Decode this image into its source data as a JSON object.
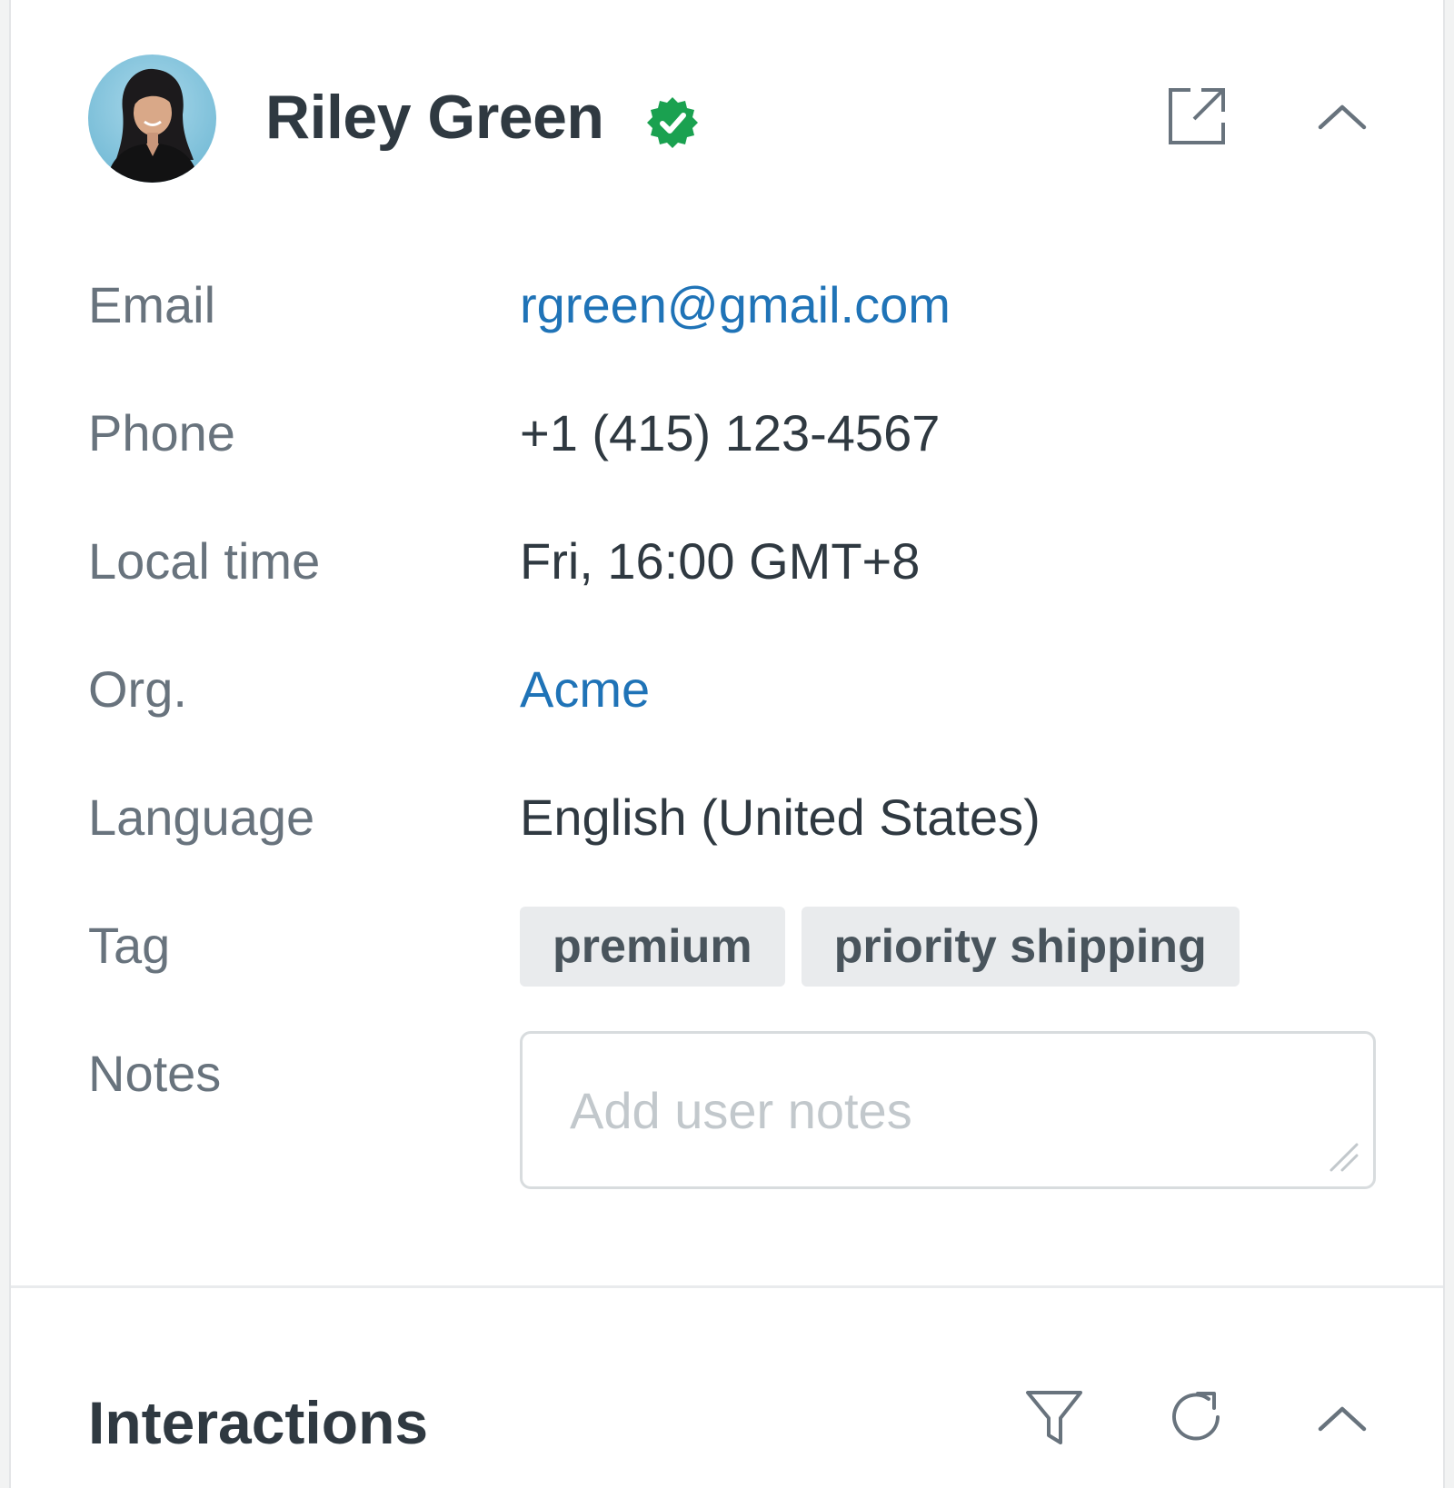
{
  "user": {
    "name": "Riley Green",
    "verified": true,
    "avatar_icon": "avatar-photo"
  },
  "header": {
    "open_icon": "external-link-icon",
    "collapse_icon": "chevron-up-icon"
  },
  "fields": {
    "email": {
      "label": "Email",
      "value": "rgreen@gmail.com"
    },
    "phone": {
      "label": "Phone",
      "value": "+1 (415) 123-4567"
    },
    "local_time": {
      "label": "Local time",
      "value": "Fri, 16:00 GMT+8"
    },
    "org": {
      "label": "Org.",
      "value": "Acme"
    },
    "language": {
      "label": "Language",
      "value": "English (United States)"
    },
    "tag": {
      "label": "Tag",
      "items": [
        "premium",
        "priority shipping"
      ]
    },
    "notes": {
      "label": "Notes",
      "placeholder": "Add user notes",
      "value": ""
    }
  },
  "interactions": {
    "title": "Interactions",
    "filter_icon": "filter-icon",
    "refresh_icon": "refresh-icon",
    "collapse_icon": "chevron-up-icon"
  },
  "colors": {
    "link": "#1f73b7",
    "verified": "#1aa150",
    "text_primary": "#2f3941",
    "text_secondary": "#68737d",
    "tag_bg": "#e9ebed"
  }
}
